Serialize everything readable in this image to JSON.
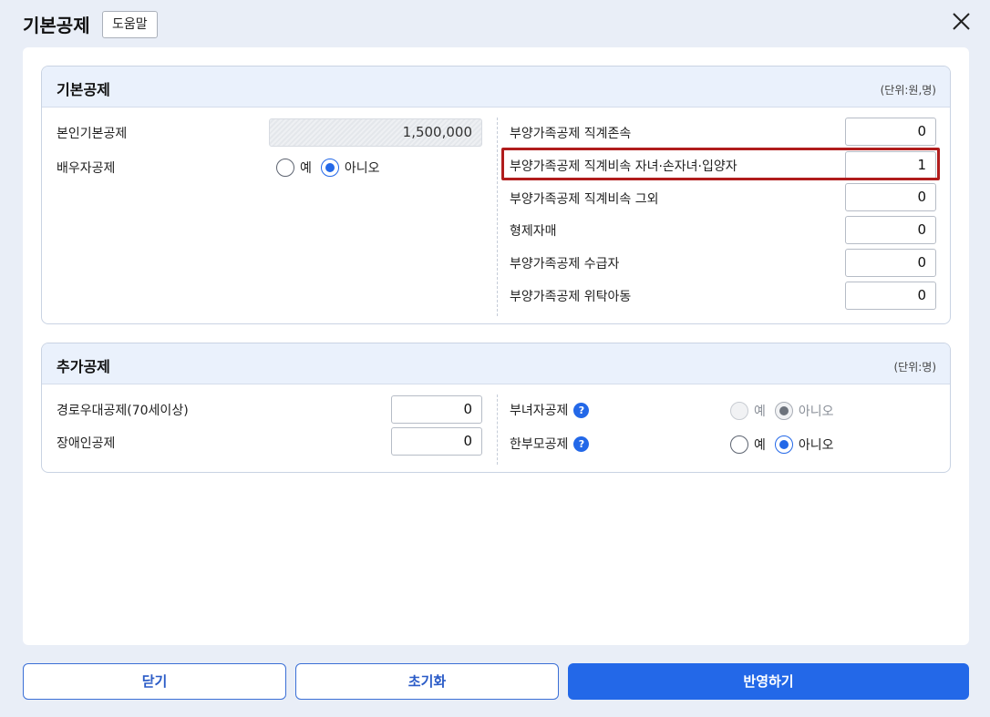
{
  "dialog": {
    "title": "기본공제",
    "help_label": "도움말"
  },
  "basic": {
    "title": "기본공제",
    "unit": "(단위:원,명)",
    "self_label": "본인기본공제",
    "self_value": "1,500,000",
    "spouse_label": "배우자공제",
    "spouse_options": [
      "예",
      "아니오"
    ],
    "spouse_selected": "아니오",
    "right_rows": [
      {
        "label": "부양가족공제 직계존속",
        "value": "0"
      },
      {
        "label": "부양가족공제 직계비속 자녀·손자녀·입양자",
        "value": "1"
      },
      {
        "label": "부양가족공제 직계비속 그외",
        "value": "0"
      },
      {
        "label": "형제자매",
        "value": "0"
      },
      {
        "label": "부양가족공제 수급자",
        "value": "0"
      },
      {
        "label": "부양가족공제 위탁아동",
        "value": "0"
      }
    ]
  },
  "additional": {
    "title": "추가공제",
    "unit": "(단위:명)",
    "elder_label": "경로우대공제(70세이상)",
    "elder_value": "0",
    "disabled_label": "장애인공제",
    "disabled_value": "0",
    "female_label": "부녀자공제",
    "female_options": [
      "예",
      "아니오"
    ],
    "female_selected": "아니오",
    "single_parent_label": "한부모공제",
    "single_parent_options": [
      "예",
      "아니오"
    ],
    "single_parent_selected": "아니오",
    "help_icon": "?"
  },
  "footer": {
    "close_label": "닫기",
    "reset_label": "초기화",
    "apply_label": "반영하기"
  },
  "colors": {
    "accent": "#2368e8",
    "highlight": "#b01c1c",
    "background": "#e9eef7"
  }
}
